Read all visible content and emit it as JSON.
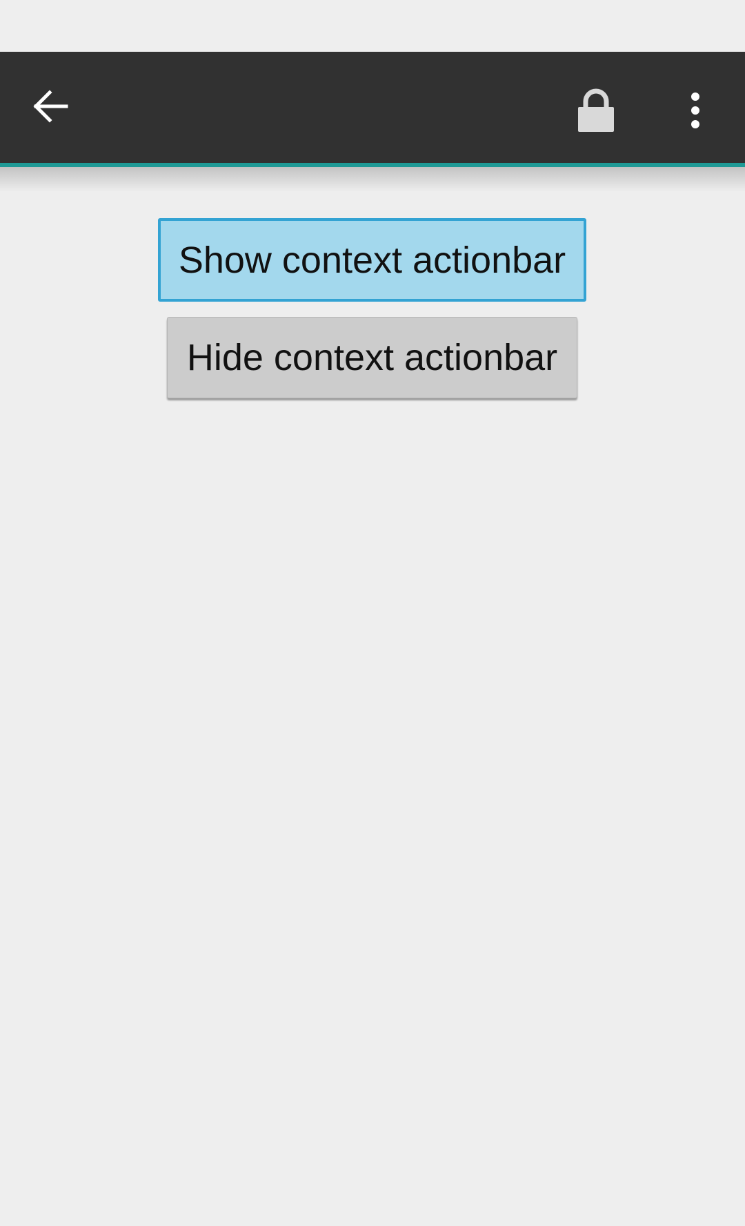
{
  "action_bar": {
    "back_icon": "arrow-left-icon",
    "lock_icon": "lock-icon",
    "overflow_icon": "more-vert-icon",
    "background_color": "#313131",
    "accent_color": "#1f9a96"
  },
  "main": {
    "show_button_label": "Show context actionbar",
    "hide_button_label": "Hide context actionbar"
  }
}
